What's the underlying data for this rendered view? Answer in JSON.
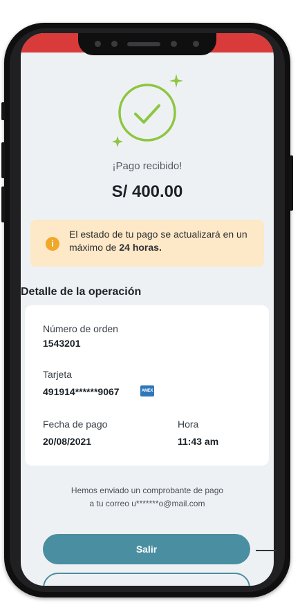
{
  "confirmation": {
    "status_text": "¡Pago recibido!",
    "amount": "S/ 400.00",
    "success_color": "#8dc63f"
  },
  "alert": {
    "text_before": "El estado de tu pago se actualizará en un máximo de ",
    "text_bold": "24 horas.",
    "icon": "info-icon"
  },
  "details": {
    "title": "Detalle de la operación",
    "order_label": "Número de orden",
    "order_value": "1543201",
    "card_label": "Tarjeta",
    "card_value": "491914******9067",
    "card_brand_icon": "amex-icon",
    "date_label": "Fecha de pago",
    "date_value": "20/08/2021",
    "time_label": "Hora",
    "time_value": "11:43 am"
  },
  "receipt": {
    "line1": "Hemos enviado un comprobante de pago",
    "line2": "a tu correo u*******o@mail.com"
  },
  "actions": {
    "exit_label": "Salir",
    "primary_color": "#4a8ea1"
  },
  "colors": {
    "status_bar": "#d93a3a",
    "alert_bg": "#fde8c7",
    "alert_icon": "#f0a82b"
  }
}
